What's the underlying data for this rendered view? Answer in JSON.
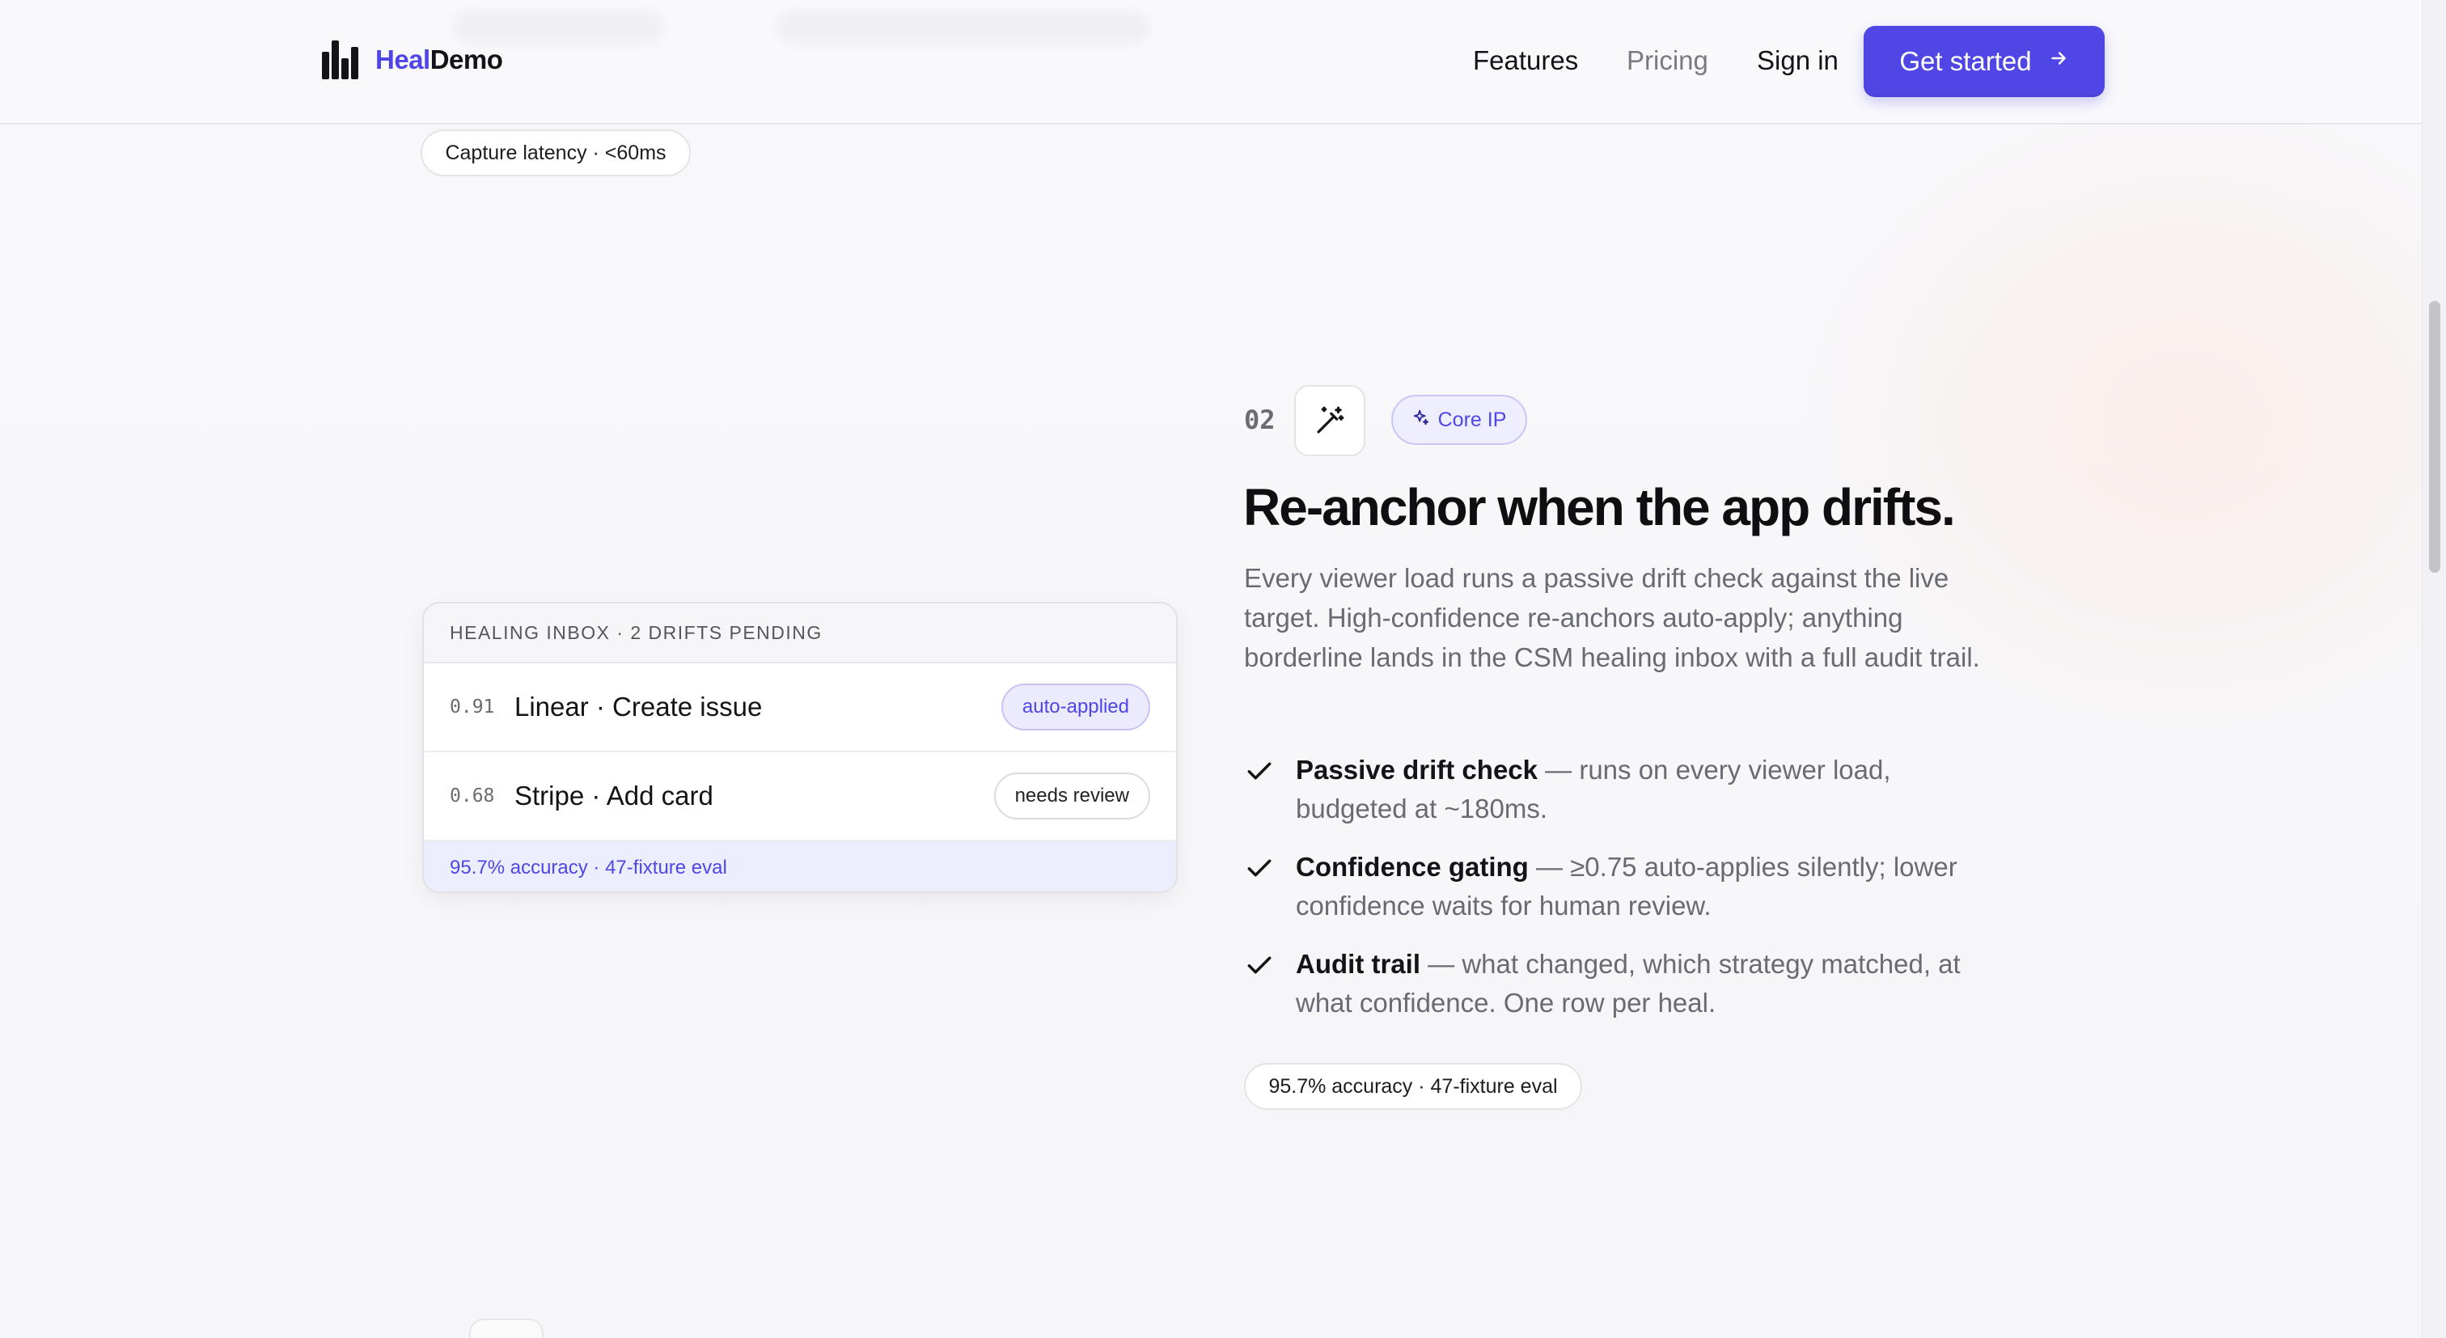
{
  "brand": {
    "name_part1": "Heal",
    "name_part2": "Demo"
  },
  "nav": {
    "features": "Features",
    "pricing": "Pricing",
    "sign_in": "Sign in",
    "get_started": "Get started"
  },
  "prev_section": {
    "chip": "Capture latency · <60ms"
  },
  "section": {
    "number": "02",
    "tag": "Core IP",
    "title": "Re-anchor when the app drifts.",
    "description": "Every viewer load runs a passive drift check against the live target. High-confidence re-anchors auto-apply; anything borderline lands in the CSM healing inbox with a full audit trail.",
    "features": [
      {
        "title": "Passive drift check",
        "text": " — runs on every viewer load, budgeted at ~180ms."
      },
      {
        "title": "Confidence gating",
        "text": " — ≥0.75 auto-applies silently; lower confidence waits for human review."
      },
      {
        "title": "Audit trail",
        "text": " — what changed, which strategy matched, at what confidence. One row per heal."
      }
    ],
    "chip": "95.7% accuracy · 47-fixture eval"
  },
  "inbox": {
    "header": "HEALING INBOX · 2 DRIFTS PENDING",
    "rows": [
      {
        "score": "0.91",
        "label": "Linear · Create issue",
        "badge": "auto-applied"
      },
      {
        "score": "0.68",
        "label": "Stripe · Add card",
        "badge": "needs review"
      }
    ],
    "footer": "95.7% accuracy · 47-fixture eval"
  },
  "colors": {
    "accent": "#4f46e5",
    "text": "#111114",
    "muted": "#6a6a72"
  },
  "icons": [
    "logo-bars-icon",
    "arrow-right-icon",
    "magic-wand-icon",
    "sparkle-icon",
    "check-icon"
  ]
}
